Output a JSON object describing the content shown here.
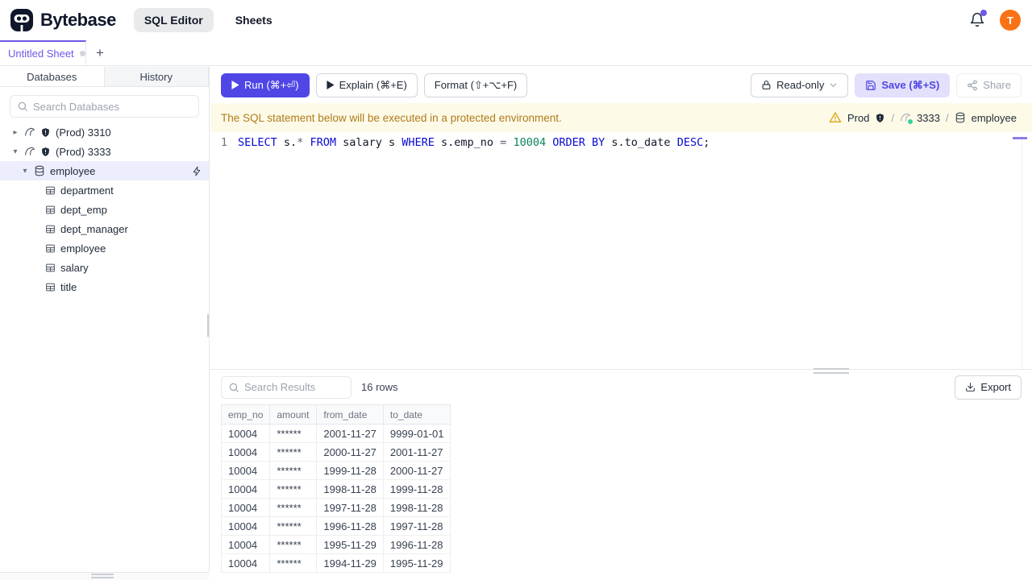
{
  "brand": {
    "name": "Bytebase"
  },
  "header": {
    "nav": [
      {
        "label": "SQL Editor",
        "active": true
      },
      {
        "label": "Sheets",
        "active": false
      }
    ],
    "avatar_initial": "T"
  },
  "sheet_tabs": {
    "active_tab": "Untitled Sheet",
    "add_label": "+"
  },
  "sidebar": {
    "tabs": [
      {
        "label": "Databases",
        "active": true
      },
      {
        "label": "History",
        "active": false
      }
    ],
    "search_placeholder": "Search Databases",
    "instances": [
      {
        "label": "(Prod) 3310",
        "expanded": false
      },
      {
        "label": "(Prod) 3333",
        "expanded": true
      }
    ],
    "database": "employee",
    "tables": [
      "department",
      "dept_emp",
      "dept_manager",
      "employee",
      "salary",
      "title"
    ]
  },
  "toolbar": {
    "run": "Run (⌘+⏎)",
    "explain": "Explain (⌘+E)",
    "format": "Format (⇧+⌥+F)",
    "mode": "Read-only",
    "save": "Save (⌘+S)",
    "share": "Share"
  },
  "banner": {
    "message": "The SQL statement below will be executed in a protected environment.",
    "environment": "Prod",
    "separator": "/",
    "instance": "3333",
    "database": "employee"
  },
  "editor": {
    "line_number": "1",
    "tokens": [
      {
        "text": "SELECT",
        "type": "keyword"
      },
      {
        "text": " s.",
        "type": "plain"
      },
      {
        "text": "*",
        "type": "operator"
      },
      {
        "text": " ",
        "type": "plain"
      },
      {
        "text": "FROM",
        "type": "keyword"
      },
      {
        "text": " salary s ",
        "type": "plain"
      },
      {
        "text": "WHERE",
        "type": "keyword"
      },
      {
        "text": " s.emp_no ",
        "type": "plain"
      },
      {
        "text": "=",
        "type": "operator"
      },
      {
        "text": " ",
        "type": "plain"
      },
      {
        "text": "10004",
        "type": "number"
      },
      {
        "text": " ",
        "type": "plain"
      },
      {
        "text": "ORDER",
        "type": "keyword"
      },
      {
        "text": " ",
        "type": "plain"
      },
      {
        "text": "BY",
        "type": "keyword"
      },
      {
        "text": " s.to_date ",
        "type": "plain"
      },
      {
        "text": "DESC",
        "type": "keyword"
      },
      {
        "text": ";",
        "type": "plain"
      }
    ]
  },
  "results": {
    "search_placeholder": "Search Results",
    "row_count": "16 rows",
    "export_label": "Export",
    "columns": [
      "emp_no",
      "amount",
      "from_date",
      "to_date"
    ],
    "rows": [
      [
        "10004",
        "******",
        "2001-11-27",
        "9999-01-01"
      ],
      [
        "10004",
        "******",
        "2000-11-27",
        "2001-11-27"
      ],
      [
        "10004",
        "******",
        "1999-11-28",
        "2000-11-27"
      ],
      [
        "10004",
        "******",
        "1998-11-28",
        "1999-11-28"
      ],
      [
        "10004",
        "******",
        "1997-11-28",
        "1998-11-28"
      ],
      [
        "10004",
        "******",
        "1996-11-28",
        "1997-11-28"
      ],
      [
        "10004",
        "******",
        "1995-11-29",
        "1996-11-28"
      ],
      [
        "10004",
        "******",
        "1994-11-29",
        "1995-11-29"
      ]
    ]
  },
  "colors": {
    "accent": "#4f46e5",
    "warning_text": "#b07a1e",
    "warning_bg": "#fdfbe7",
    "avatar": "#f97316",
    "sql_keyword": "#0a0ad2",
    "sql_number": "#098658",
    "status_online": "#34d399"
  }
}
